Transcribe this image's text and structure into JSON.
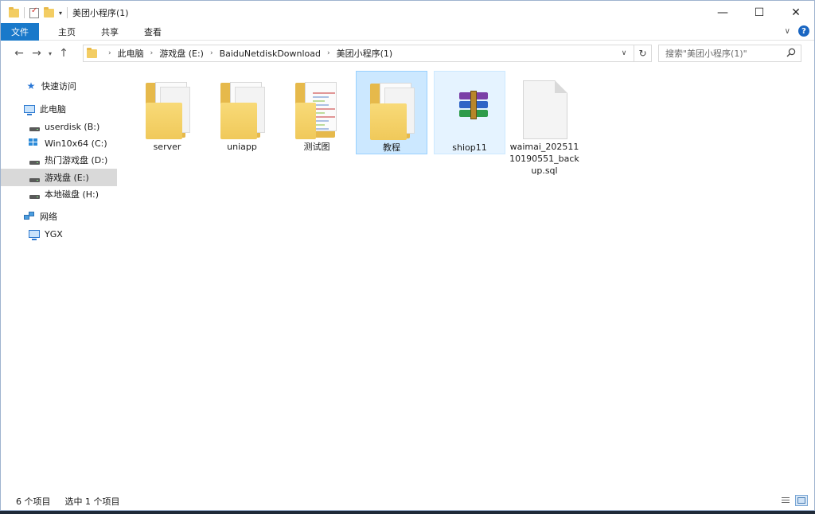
{
  "window": {
    "title": "美团小程序(1)",
    "controls": {
      "minimize": "—",
      "maximize": "☐",
      "close": "✕"
    }
  },
  "ribbon": {
    "tabs": [
      {
        "label": "文件",
        "kind": "file"
      },
      {
        "label": "主页",
        "kind": "plain"
      },
      {
        "label": "共享",
        "kind": "plain"
      },
      {
        "label": "查看",
        "kind": "plain"
      }
    ],
    "help_label": "?"
  },
  "address": {
    "path": [
      "此电脑",
      "游戏盘 (E:)",
      "BaiduNetdiskDownload",
      "美团小程序(1)"
    ],
    "search_placeholder": "搜索\"美团小程序(1)\""
  },
  "nav": {
    "items": [
      {
        "label": "快速访问",
        "icon": "star-icon",
        "indent": 0,
        "selected": false
      },
      {
        "label": "此电脑",
        "icon": "pc-icon",
        "indent": 0,
        "selected": false
      },
      {
        "label": "userdisk (B:)",
        "icon": "drive-icon",
        "indent": 1,
        "selected": false
      },
      {
        "label": "Win10x64 (C:)",
        "icon": "windows-drive-icon",
        "indent": 1,
        "selected": false
      },
      {
        "label": "热门游戏盘 (D:)",
        "icon": "drive-icon",
        "indent": 1,
        "selected": false
      },
      {
        "label": "游戏盘 (E:)",
        "icon": "drive-icon",
        "indent": 1,
        "selected": true
      },
      {
        "label": "本地磁盘 (H:)",
        "icon": "drive-icon",
        "indent": 1,
        "selected": false
      },
      {
        "label": "网络",
        "icon": "network-icon",
        "indent": 0,
        "selected": false
      },
      {
        "label": "YGX",
        "icon": "pc-icon",
        "indent": 1,
        "selected": false
      }
    ]
  },
  "files": [
    {
      "name": "server",
      "type": "folder",
      "state": "normal"
    },
    {
      "name": "uniapp",
      "type": "folder",
      "state": "normal"
    },
    {
      "name": "测试图",
      "type": "folder-doc",
      "state": "normal"
    },
    {
      "name": "教程",
      "type": "folder",
      "state": "selected"
    },
    {
      "name": "shiop11",
      "type": "rar",
      "state": "hover"
    },
    {
      "name": "waimai_20251110190551_backup.sql",
      "type": "file",
      "state": "normal",
      "display_lines": [
        "waimai_202511",
        "10190551_back",
        "up.sql"
      ]
    }
  ],
  "status": {
    "item_count": "6 个项目",
    "selection": "选中 1 个项目"
  },
  "colors": {
    "accent": "#1979ca",
    "selected_tile": "#cce8ff",
    "hover_tile": "#e5f3ff",
    "folder": "#f0c95a"
  }
}
